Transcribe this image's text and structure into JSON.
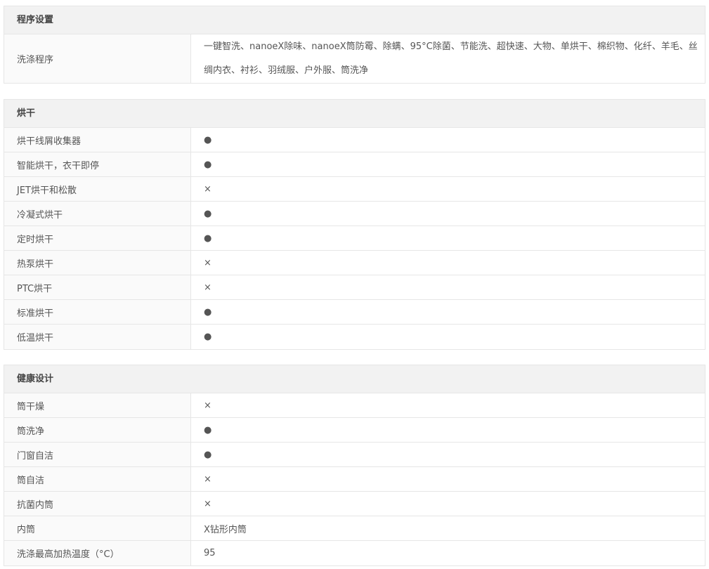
{
  "sections": [
    {
      "title": "程序设置",
      "rows": [
        {
          "label": "洗涤程序",
          "value": "一键智洗、nanoeX除味、nanoeX筒防霉、除螨、95°C除菌、节能洗、超快速、大物、单烘干、棉织物、化纤、羊毛、丝绸内衣、衬衫、羽绒服、户外服、筒洗净"
        }
      ]
    },
    {
      "title": "烘干",
      "rows": [
        {
          "label": "烘干线屑收集器",
          "value": "●"
        },
        {
          "label": "智能烘干，衣干即停",
          "value": "●"
        },
        {
          "label": "JET烘干和松散",
          "value": "×"
        },
        {
          "label": "冷凝式烘干",
          "value": "●"
        },
        {
          "label": "定时烘干",
          "value": "●"
        },
        {
          "label": "热泵烘干",
          "value": "×"
        },
        {
          "label": "PTC烘干",
          "value": "×"
        },
        {
          "label": "标准烘干",
          "value": "●"
        },
        {
          "label": "低温烘干",
          "value": "●"
        }
      ]
    },
    {
      "title": "健康设计",
      "rows": [
        {
          "label": "筒干燥",
          "value": "×"
        },
        {
          "label": "筒洗净",
          "value": "●"
        },
        {
          "label": "门窗自洁",
          "value": "●"
        },
        {
          "label": "筒自洁",
          "value": "×"
        },
        {
          "label": "抗菌内筒",
          "value": "×"
        },
        {
          "label": "内筒",
          "value": "X钻形内筒"
        },
        {
          "label": "洗涤最高加热温度（°C）",
          "value": "95"
        }
      ]
    }
  ]
}
